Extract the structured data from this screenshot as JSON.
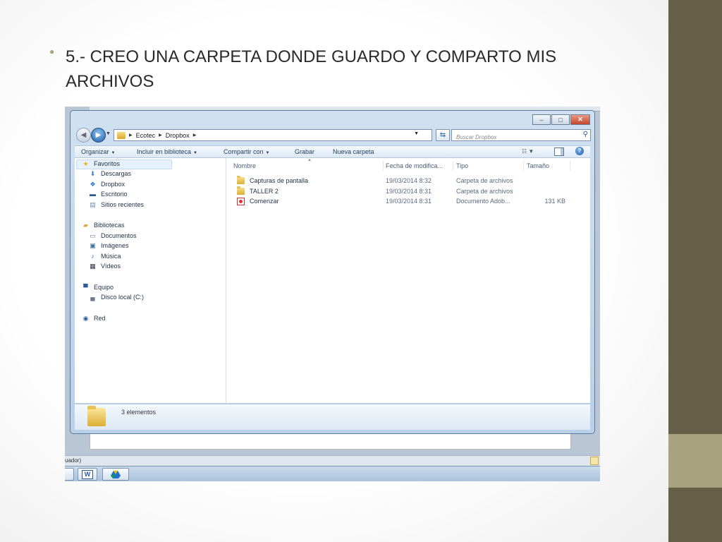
{
  "slide": {
    "bullet_text": "5.- CREO UNA CARPETA DONDE GUARDO Y COMPARTO MIS ARCHIVOS",
    "accent_color": "#675e48",
    "accent_light": "#a7a27f"
  },
  "explorer": {
    "window_controls": {
      "minimize": "–",
      "maximize": "□",
      "close": "✕"
    },
    "address": {
      "crumbs": [
        "Ecotec",
        "Dropbox"
      ]
    },
    "search": {
      "placeholder": "Buscar Dropbox"
    },
    "toolbar": {
      "organize": "Organizar",
      "include_library": "Incluir en biblioteca",
      "share_with": "Compartir con",
      "burn": "Grabar",
      "new_folder": "Nueva carpeta"
    },
    "nav_pane": {
      "favorites": {
        "label": "Favoritos",
        "items": [
          "Descargas",
          "Dropbox",
          "Escritorio",
          "Sitios recientes"
        ]
      },
      "libraries": {
        "label": "Bibliotecas",
        "items": [
          "Documentos",
          "Imágenes",
          "Música",
          "Vídeos"
        ]
      },
      "computer": {
        "label": "Equipo",
        "items": [
          "Disco local (C:)"
        ]
      },
      "network": {
        "label": "Red"
      }
    },
    "columns": {
      "name": "Nombre",
      "date": "Fecha de modifica...",
      "type": "Tipo",
      "size": "Tamaño"
    },
    "files": [
      {
        "name": "Capturas de pantalla",
        "date": "19/03/2014 8:32",
        "type": "Carpeta de archivos",
        "size": "",
        "icon": "folder-icon"
      },
      {
        "name": "TALLER 2",
        "date": "19/03/2014 8:31",
        "type": "Carpeta de archivos",
        "size": "",
        "icon": "folder-icon"
      },
      {
        "name": "Comenzar",
        "date": "19/03/2014 8:31",
        "type": "Documento Adob...",
        "size": "131 KB",
        "icon": "pdf-icon"
      }
    ],
    "details": {
      "item_count": "3 elementos"
    }
  },
  "word_status": {
    "text": "uador)"
  },
  "taskbar": {
    "word_label": "W"
  }
}
